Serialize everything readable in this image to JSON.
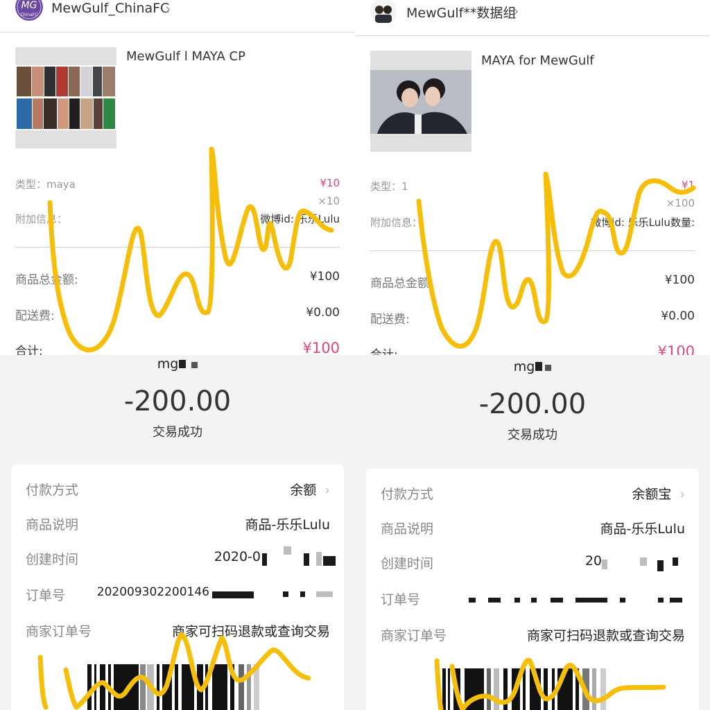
{
  "left": {
    "shop": {
      "name": "MewGulf_ChinaFC",
      "avatar_text": "MG",
      "avatar_sub": "ChinaFC"
    },
    "item_title": "MewGulf l MAYA CP",
    "type_label": "类型：maya",
    "unit_price": "¥10",
    "quantity": "×10",
    "extra_label": "附加信息：",
    "extra_value": "微博id: 乐乐Lulu",
    "subtotal_label": "商品总金额:",
    "subtotal_value": "¥100",
    "shipping_label": "配送费:",
    "shipping_value": "¥0.00",
    "total_label": "合计:",
    "total_value": "¥100",
    "payee": "mg",
    "amount": "-200.00",
    "status": "交易成功",
    "rows": [
      {
        "label": "付款方式",
        "value": "余额"
      },
      {
        "label": "商品说明",
        "value": "商品-乐乐Lulu"
      },
      {
        "label": "创建时间",
        "value": "2020-0"
      },
      {
        "label": "订单号",
        "value": "202009302200146"
      },
      {
        "label": "商家订单号",
        "value": "商家可扫码退款或查询交易"
      }
    ]
  },
  "right": {
    "shop": {
      "name": "MewGulf**数据组"
    },
    "item_title": "MAYA for MewGulf",
    "type_label": "类型：1",
    "unit_price": "¥1",
    "quantity": "×100",
    "extra_label": "附加信息：",
    "extra_value": "微博id: 乐乐Lulu数量:",
    "subtotal_label": "商品总金额:",
    "subtotal_value": "¥100",
    "shipping_label": "配送费:",
    "shipping_value": "¥0.00",
    "total_label": "合计:",
    "total_value": "¥100",
    "payee": "mg",
    "amount": "-200.00",
    "status": "交易成功",
    "rows": [
      {
        "label": "付款方式",
        "value": "余额宝"
      },
      {
        "label": "商品说明",
        "value": "商品-乐乐Lulu"
      },
      {
        "label": "创建时间",
        "value": "20"
      },
      {
        "label": "订单号",
        "value": ""
      },
      {
        "label": "商家订单号",
        "value": "商家可扫码退款或查询交易"
      }
    ]
  },
  "icons": {
    "chevron": "chevron-right-icon"
  },
  "colors": {
    "price_pink": "#e0467a",
    "scribble": "#f5be0b",
    "payment_bg": "#f3f3f3"
  }
}
